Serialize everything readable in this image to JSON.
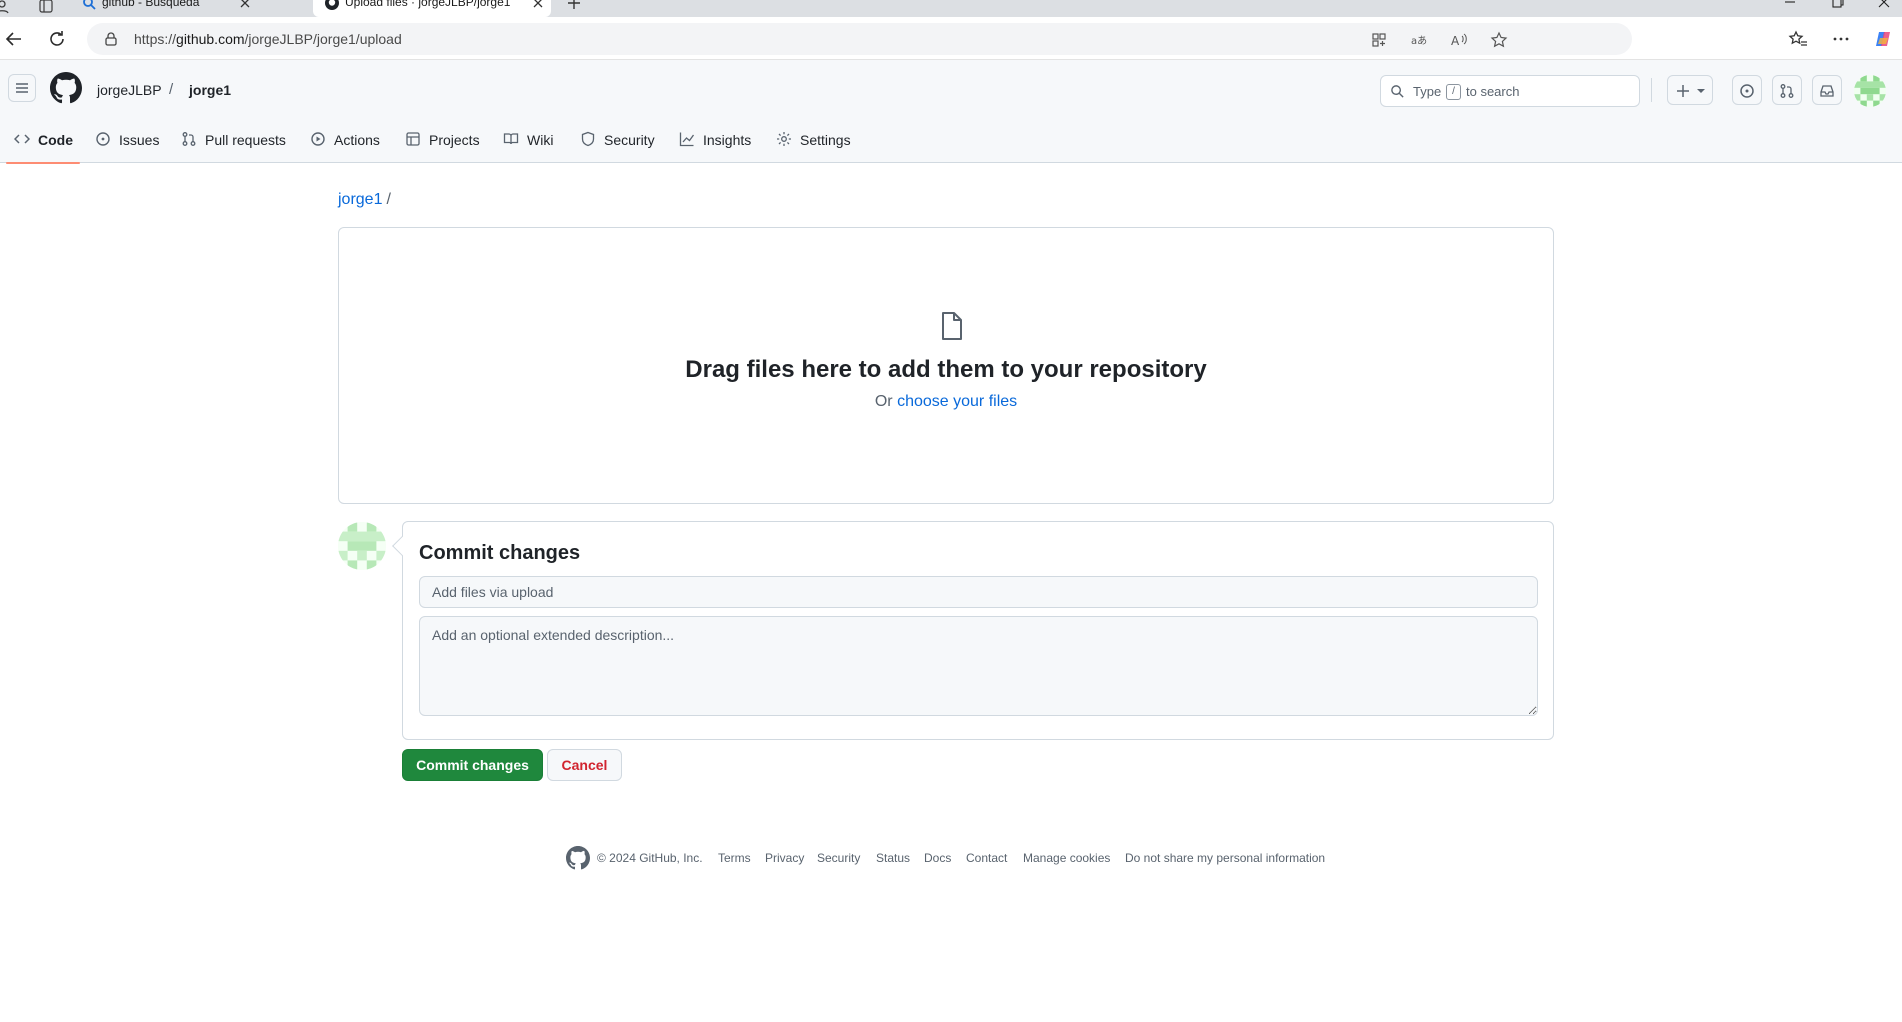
{
  "browser": {
    "tabs": [
      {
        "title": "github - Búsqueda",
        "active": false
      },
      {
        "title": "Upload files · jorgeJLBP/jorge1",
        "active": true
      }
    ],
    "url_prefix": "https://",
    "url_host": "github.com",
    "url_path": "/jorgeJLBP/jorge1/upload"
  },
  "header": {
    "owner": "jorgeJLBP",
    "separator": "/",
    "repo": "jorge1",
    "search_prefix": "Type",
    "search_key": "/",
    "search_suffix": "to search"
  },
  "repo_nav": [
    {
      "label": "Code",
      "icon": "code-icon",
      "selected": true
    },
    {
      "label": "Issues",
      "icon": "issue-opened-icon"
    },
    {
      "label": "Pull requests",
      "icon": "git-pull-request-icon"
    },
    {
      "label": "Actions",
      "icon": "play-icon"
    },
    {
      "label": "Projects",
      "icon": "table-icon"
    },
    {
      "label": "Wiki",
      "icon": "book-icon"
    },
    {
      "label": "Security",
      "icon": "shield-icon"
    },
    {
      "label": "Insights",
      "icon": "graph-icon"
    },
    {
      "label": "Settings",
      "icon": "gear-icon"
    }
  ],
  "breadcrumb": {
    "repo": "jorge1",
    "slash": "/"
  },
  "dropzone": {
    "title": "Drag files here to add them to your repository",
    "prefix": "Or",
    "link": "choose your files"
  },
  "commit": {
    "title": "Commit changes",
    "summary_placeholder": "Add files via upload",
    "description_placeholder": "Add an optional extended description...",
    "commit_button": "Commit changes",
    "cancel_button": "Cancel"
  },
  "footer": {
    "copyright": "© 2024 GitHub, Inc.",
    "links": [
      "Terms",
      "Privacy",
      "Security",
      "Status",
      "Docs",
      "Contact",
      "Manage cookies",
      "Do not share my personal information"
    ]
  },
  "colors": {
    "accent_link": "#0969da",
    "primary_button": "#1f883d",
    "danger_text": "#d1242f",
    "selected_tab_underline": "#fd8c73"
  }
}
